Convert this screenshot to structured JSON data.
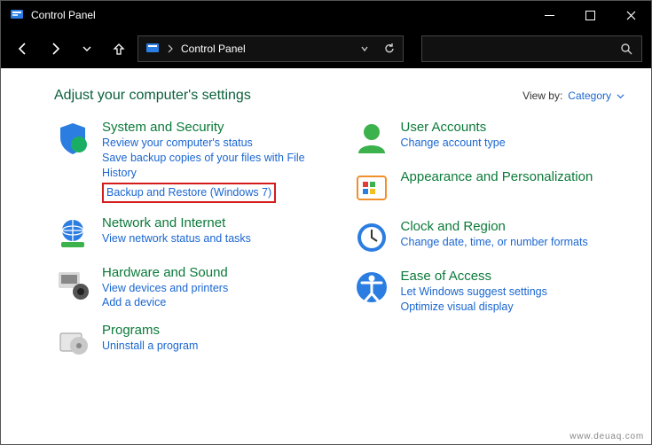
{
  "window": {
    "title": "Control Panel"
  },
  "breadcrumb": {
    "path": "Control Panel"
  },
  "page_title": "Adjust your computer's settings",
  "viewby": {
    "label": "View by:",
    "value": "Category"
  },
  "left_column": [
    {
      "heading": "System and Security",
      "tasks": [
        "Review your computer's status",
        "Save backup copies of your files with File History",
        "Backup and Restore (Windows 7)"
      ],
      "highlight_task_index": 2
    },
    {
      "heading": "Network and Internet",
      "tasks": [
        "View network status and tasks"
      ]
    },
    {
      "heading": "Hardware and Sound",
      "tasks": [
        "View devices and printers",
        "Add a device"
      ]
    },
    {
      "heading": "Programs",
      "tasks": [
        "Uninstall a program"
      ]
    }
  ],
  "right_column": [
    {
      "heading": "User Accounts",
      "tasks": [
        "Change account type"
      ]
    },
    {
      "heading": "Appearance and Personalization",
      "tasks": []
    },
    {
      "heading": "Clock and Region",
      "tasks": [
        "Change date, time, or number formats"
      ]
    },
    {
      "heading": "Ease of Access",
      "tasks": [
        "Let Windows suggest settings",
        "Optimize visual display"
      ]
    }
  ],
  "watermark": "www.deuaq.com"
}
